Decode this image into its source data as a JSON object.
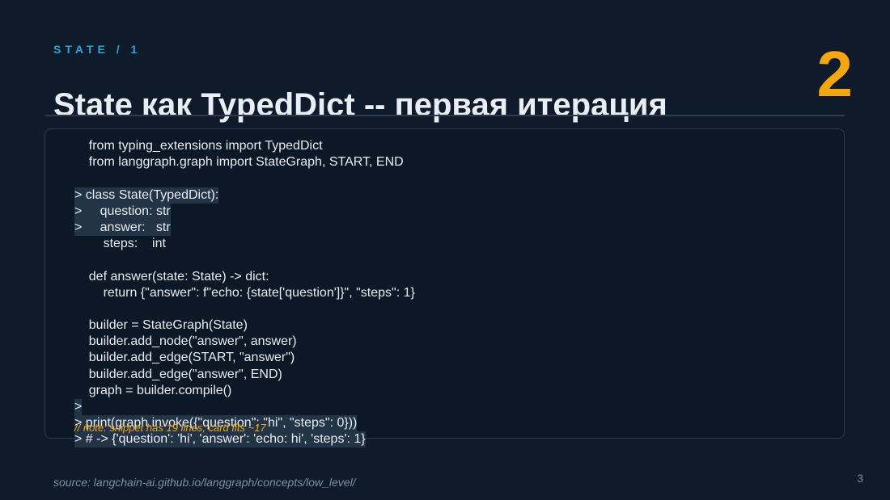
{
  "slide": {
    "kicker": "STATE / 1",
    "number": "2",
    "title": "State как TypedDict -- первая итерация",
    "code_lines": [
      {
        "text": "    from typing_extensions import TypedDict",
        "highlighted": false
      },
      {
        "text": "    from langgraph.graph import StateGraph, START, END",
        "highlighted": false
      },
      {
        "text": "",
        "highlighted": false
      },
      {
        "text": "> class State(TypedDict):",
        "highlighted": true
      },
      {
        "text": ">     question: str",
        "highlighted": true
      },
      {
        "text": ">     answer:   str",
        "highlighted": true
      },
      {
        "text": "        steps:    int",
        "highlighted": false
      },
      {
        "text": "",
        "highlighted": false
      },
      {
        "text": "    def answer(state: State) -> dict:",
        "highlighted": false
      },
      {
        "text": "        return {\"answer\": f\"echo: {state['question']}\", \"steps\": 1}",
        "highlighted": false
      },
      {
        "text": "",
        "highlighted": false
      },
      {
        "text": "    builder = StateGraph(State)",
        "highlighted": false
      },
      {
        "text": "    builder.add_node(\"answer\", answer)",
        "highlighted": false
      },
      {
        "text": "    builder.add_edge(START, \"answer\")",
        "highlighted": false
      },
      {
        "text": "    builder.add_edge(\"answer\", END)",
        "highlighted": false
      },
      {
        "text": "    graph = builder.compile()",
        "highlighted": false
      },
      {
        "text": ">",
        "highlighted": true
      },
      {
        "text": "> print(graph.invoke({\"question\": \"hi\", \"steps\": 0}))",
        "highlighted": true
      },
      {
        "text": "> # -> {'question': 'hi', 'answer': 'echo: hi', 'steps': 1}",
        "highlighted": true
      }
    ],
    "note": "// note: snippet has 19 lines; card fits ~17",
    "source": "source: langchain-ai.github.io/langgraph/concepts/low_level/",
    "page": "3"
  },
  "colors": {
    "background": "#0f1b2b",
    "accent_blue": "#2aa4d6",
    "accent_orange": "#f5a711",
    "text": "#e9eef5",
    "muted": "#7d8ea3",
    "highlight": "#243447"
  }
}
